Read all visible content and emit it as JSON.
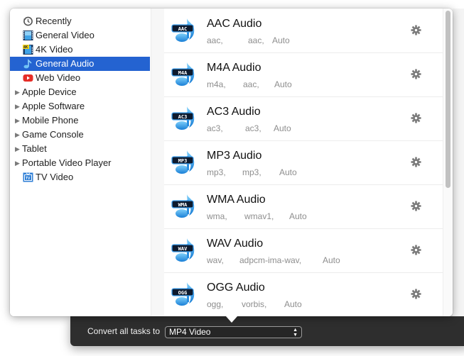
{
  "sidebar": {
    "items": [
      {
        "label": "Recently",
        "icon": "clock-icon",
        "expandable": false,
        "selected": false
      },
      {
        "label": "General Video",
        "icon": "film-icon",
        "expandable": false,
        "selected": false
      },
      {
        "label": "4K Video",
        "icon": "4k-film-icon",
        "expandable": false,
        "selected": false
      },
      {
        "label": "General Audio",
        "icon": "music-note-icon",
        "expandable": false,
        "selected": true
      },
      {
        "label": "Web Video",
        "icon": "youtube-icon",
        "expandable": false,
        "selected": false
      },
      {
        "label": "Apple Device",
        "icon": "disclosure-triangle-icon",
        "expandable": true,
        "selected": false
      },
      {
        "label": "Apple Software",
        "icon": "disclosure-triangle-icon",
        "expandable": true,
        "selected": false
      },
      {
        "label": "Mobile Phone",
        "icon": "disclosure-triangle-icon",
        "expandable": true,
        "selected": false
      },
      {
        "label": "Game Console",
        "icon": "disclosure-triangle-icon",
        "expandable": true,
        "selected": false
      },
      {
        "label": "Tablet",
        "icon": "disclosure-triangle-icon",
        "expandable": true,
        "selected": false
      },
      {
        "label": "Portable Video Player",
        "icon": "disclosure-triangle-icon",
        "expandable": true,
        "selected": false
      },
      {
        "label": "TV Video",
        "icon": "tv-icon",
        "expandable": false,
        "selected": false
      }
    ]
  },
  "formats": [
    {
      "name": "AAC Audio",
      "badge": "AAC",
      "container": "aac,",
      "codec": "aac,",
      "quality": "Auto"
    },
    {
      "name": "M4A Audio",
      "badge": "M4A",
      "container": "m4a,",
      "codec": "aac,",
      "quality": "Auto"
    },
    {
      "name": "AC3 Audio",
      "badge": "AC3",
      "container": "ac3,",
      "codec": "ac3,",
      "quality": "Auto"
    },
    {
      "name": "MP3 Audio",
      "badge": "MP3",
      "container": "mp3,",
      "codec": "mp3,",
      "quality": "Auto"
    },
    {
      "name": "WMA Audio",
      "badge": "WMA",
      "container": "wma,",
      "codec": "wmav1,",
      "quality": "Auto"
    },
    {
      "name": "WAV Audio",
      "badge": "WAV",
      "container": "wav,",
      "codec": "adpcm-ima-wav,",
      "quality": "Auto"
    },
    {
      "name": "OGG Audio",
      "badge": "OGG",
      "container": "ogg,",
      "codec": "vorbis,",
      "quality": "Auto"
    }
  ],
  "bottom_bar": {
    "label": "Convert all tasks to",
    "selected_format": "MP4 Video",
    "arrows": "▲▼"
  },
  "icons": {
    "disclosure": "▶"
  },
  "colors": {
    "selection": "#2463d1",
    "bar": "#2e2e2e"
  }
}
